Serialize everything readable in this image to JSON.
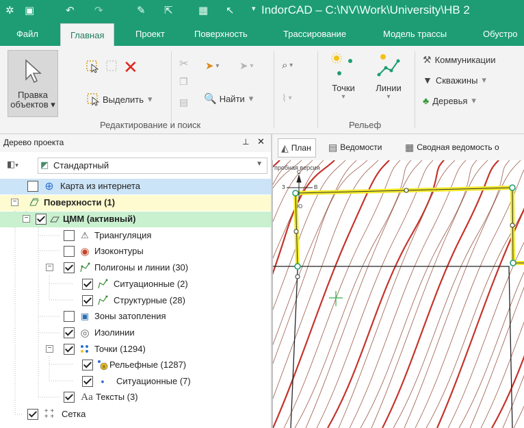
{
  "window": {
    "title": "IndorCAD – C:\\NV\\Work\\University\\HB 2"
  },
  "ribbon_tabs": [
    {
      "label": "Файл"
    },
    {
      "label": "Главная"
    },
    {
      "label": "Проект"
    },
    {
      "label": "Поверхность"
    },
    {
      "label": "Трассирование"
    },
    {
      "label": "Модель трассы"
    },
    {
      "label": "Обустро"
    }
  ],
  "ribbon": {
    "edit_objects_label": "Правка объектов",
    "select_label": "Выделить",
    "find_label": "Найти",
    "group_edit_search": "Редактирование и поиск",
    "points_label": "Точки",
    "lines_label": "Линии",
    "group_relief": "Рельеф",
    "communications_label": "Коммуникации",
    "wells_label": "Скважины",
    "trees_label": "Деревья"
  },
  "project_tree": {
    "title": "Дерево проекта",
    "combo_value": "Стандартный",
    "nodes": [
      {
        "label": "Карта из интернета",
        "checked": false,
        "icon": "globe-icon"
      },
      {
        "label": "Поверхности (1)",
        "icon": "surfaces-icon"
      },
      {
        "label": "ЦММ (активный)",
        "checked": true,
        "icon": "surface-plane-icon"
      },
      {
        "label": "Триангуляция",
        "checked": false,
        "icon": "triangle-icon"
      },
      {
        "label": "Изоконтуры",
        "checked": false,
        "icon": "isocontour-icon"
      },
      {
        "label": "Полигоны и линии (30)",
        "checked": true,
        "icon": "polyline-icon"
      },
      {
        "label": "Ситуационные (2)",
        "checked": true,
        "icon": "polyline-icon"
      },
      {
        "label": "Структурные (28)",
        "checked": true,
        "icon": "polyline-icon"
      },
      {
        "label": "Зоны затопления",
        "checked": false,
        "icon": "flood-zone-icon"
      },
      {
        "label": "Изолинии",
        "checked": true,
        "icon": "isoline-icon"
      },
      {
        "label": "Точки (1294)",
        "checked": true,
        "icon": "points-icon"
      },
      {
        "label": "Рельефные (1287)",
        "checked": true,
        "icon": "relief-point-icon"
      },
      {
        "label": "Ситуационные (7)",
        "checked": true,
        "icon": "dot-icon"
      },
      {
        "label": "Тексты (3)",
        "checked": true,
        "icon": "text-icon"
      },
      {
        "label": "Сетка",
        "checked": true,
        "icon": "grid-icon"
      }
    ]
  },
  "view_tabs": [
    {
      "label": "План"
    },
    {
      "label": "Ведомости"
    },
    {
      "label": "Сводная ведомость о"
    }
  ],
  "map": {
    "watermark": "пробная версия",
    "compass_labels": {
      "north": "С",
      "south": "Ю",
      "west": "З",
      "east": "В"
    }
  },
  "colors": {
    "brand": "#1e9d74",
    "selected": "#cce4f7",
    "surfaces_row": "#fffbd1",
    "active_row": "#c9f0cf",
    "contour_red": "#c4332b",
    "contour_brown": "#9a5a4a",
    "highlight_yellow": "#f2ea2a"
  }
}
